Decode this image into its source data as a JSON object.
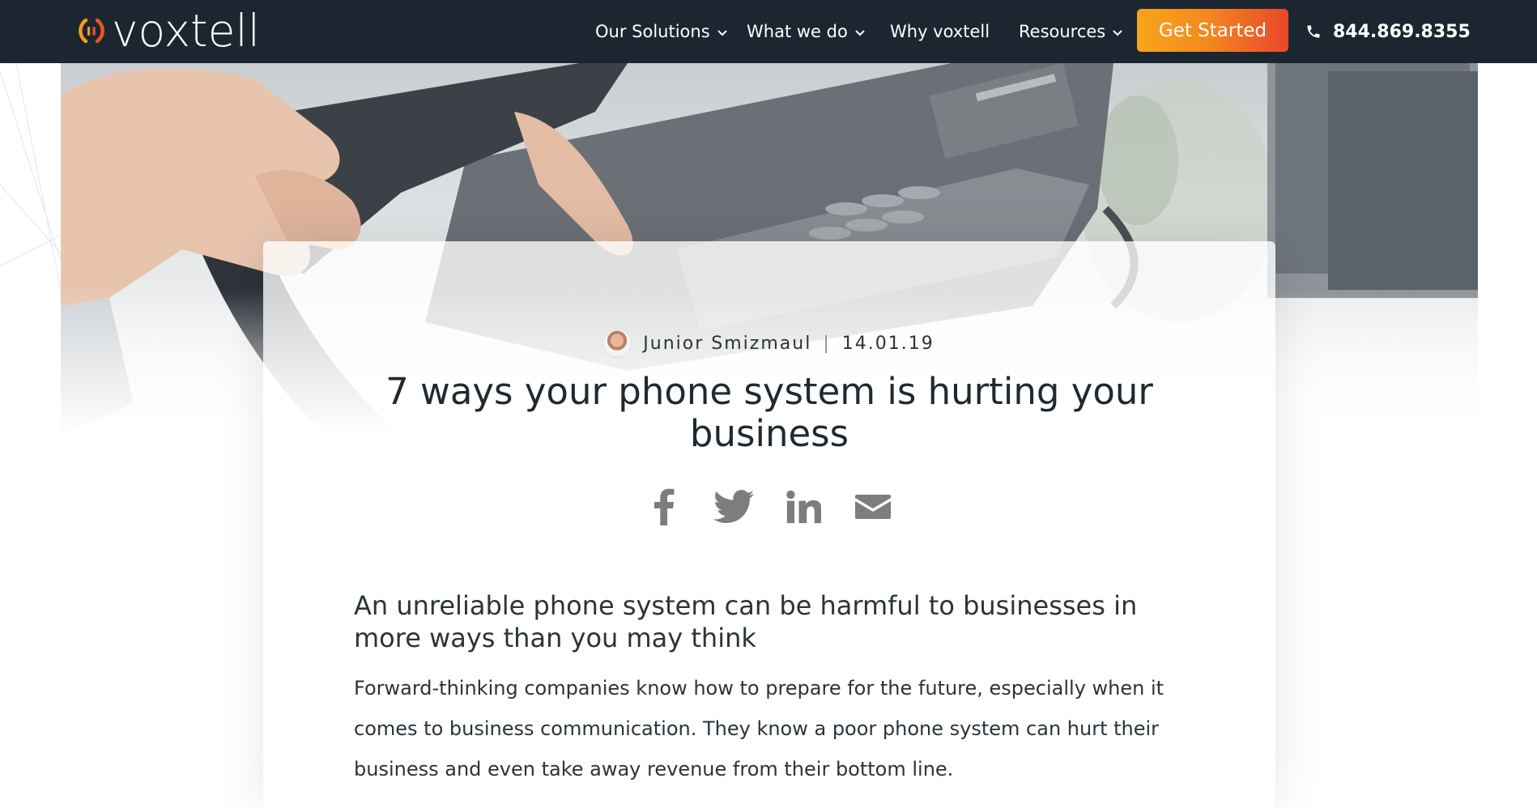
{
  "brand": {
    "name": "voxtell",
    "logo_icon": "voxtell-signal-icon"
  },
  "nav": {
    "items": [
      {
        "label": "Our Solutions",
        "has_dropdown": true
      },
      {
        "label": "What we do",
        "has_dropdown": true
      },
      {
        "label": "Why voxtell",
        "has_dropdown": false
      },
      {
        "label": "Resources",
        "has_dropdown": true
      }
    ],
    "cta_label": "Get Started",
    "phone": "844.869.8355",
    "phone_icon": "phone-icon"
  },
  "hero": {
    "image": "hand-holding-office-phone-handset"
  },
  "article": {
    "author": "Junior Smizmaul",
    "date": "14.01.19",
    "title": "7 ways your phone system is hurting your business",
    "share": [
      {
        "name": "facebook",
        "icon": "facebook-icon"
      },
      {
        "name": "twitter",
        "icon": "twitter-icon"
      },
      {
        "name": "linkedin",
        "icon": "linkedin-icon"
      },
      {
        "name": "email",
        "icon": "email-icon"
      }
    ],
    "subheading": "An unreliable phone system can be harmful to businesses in more ways than you may think",
    "paragraph": "Forward-thinking companies know how to prepare for the future, especially when it comes to business communication. They know a poor phone system can hurt their business and even take away revenue from their bottom line."
  },
  "colors": {
    "nav_bg": "#1b2630",
    "cta_start": "#f7a51c",
    "cta_end": "#e9462b",
    "text": "#1f2a30",
    "icon_gray": "#7d7d7d"
  }
}
